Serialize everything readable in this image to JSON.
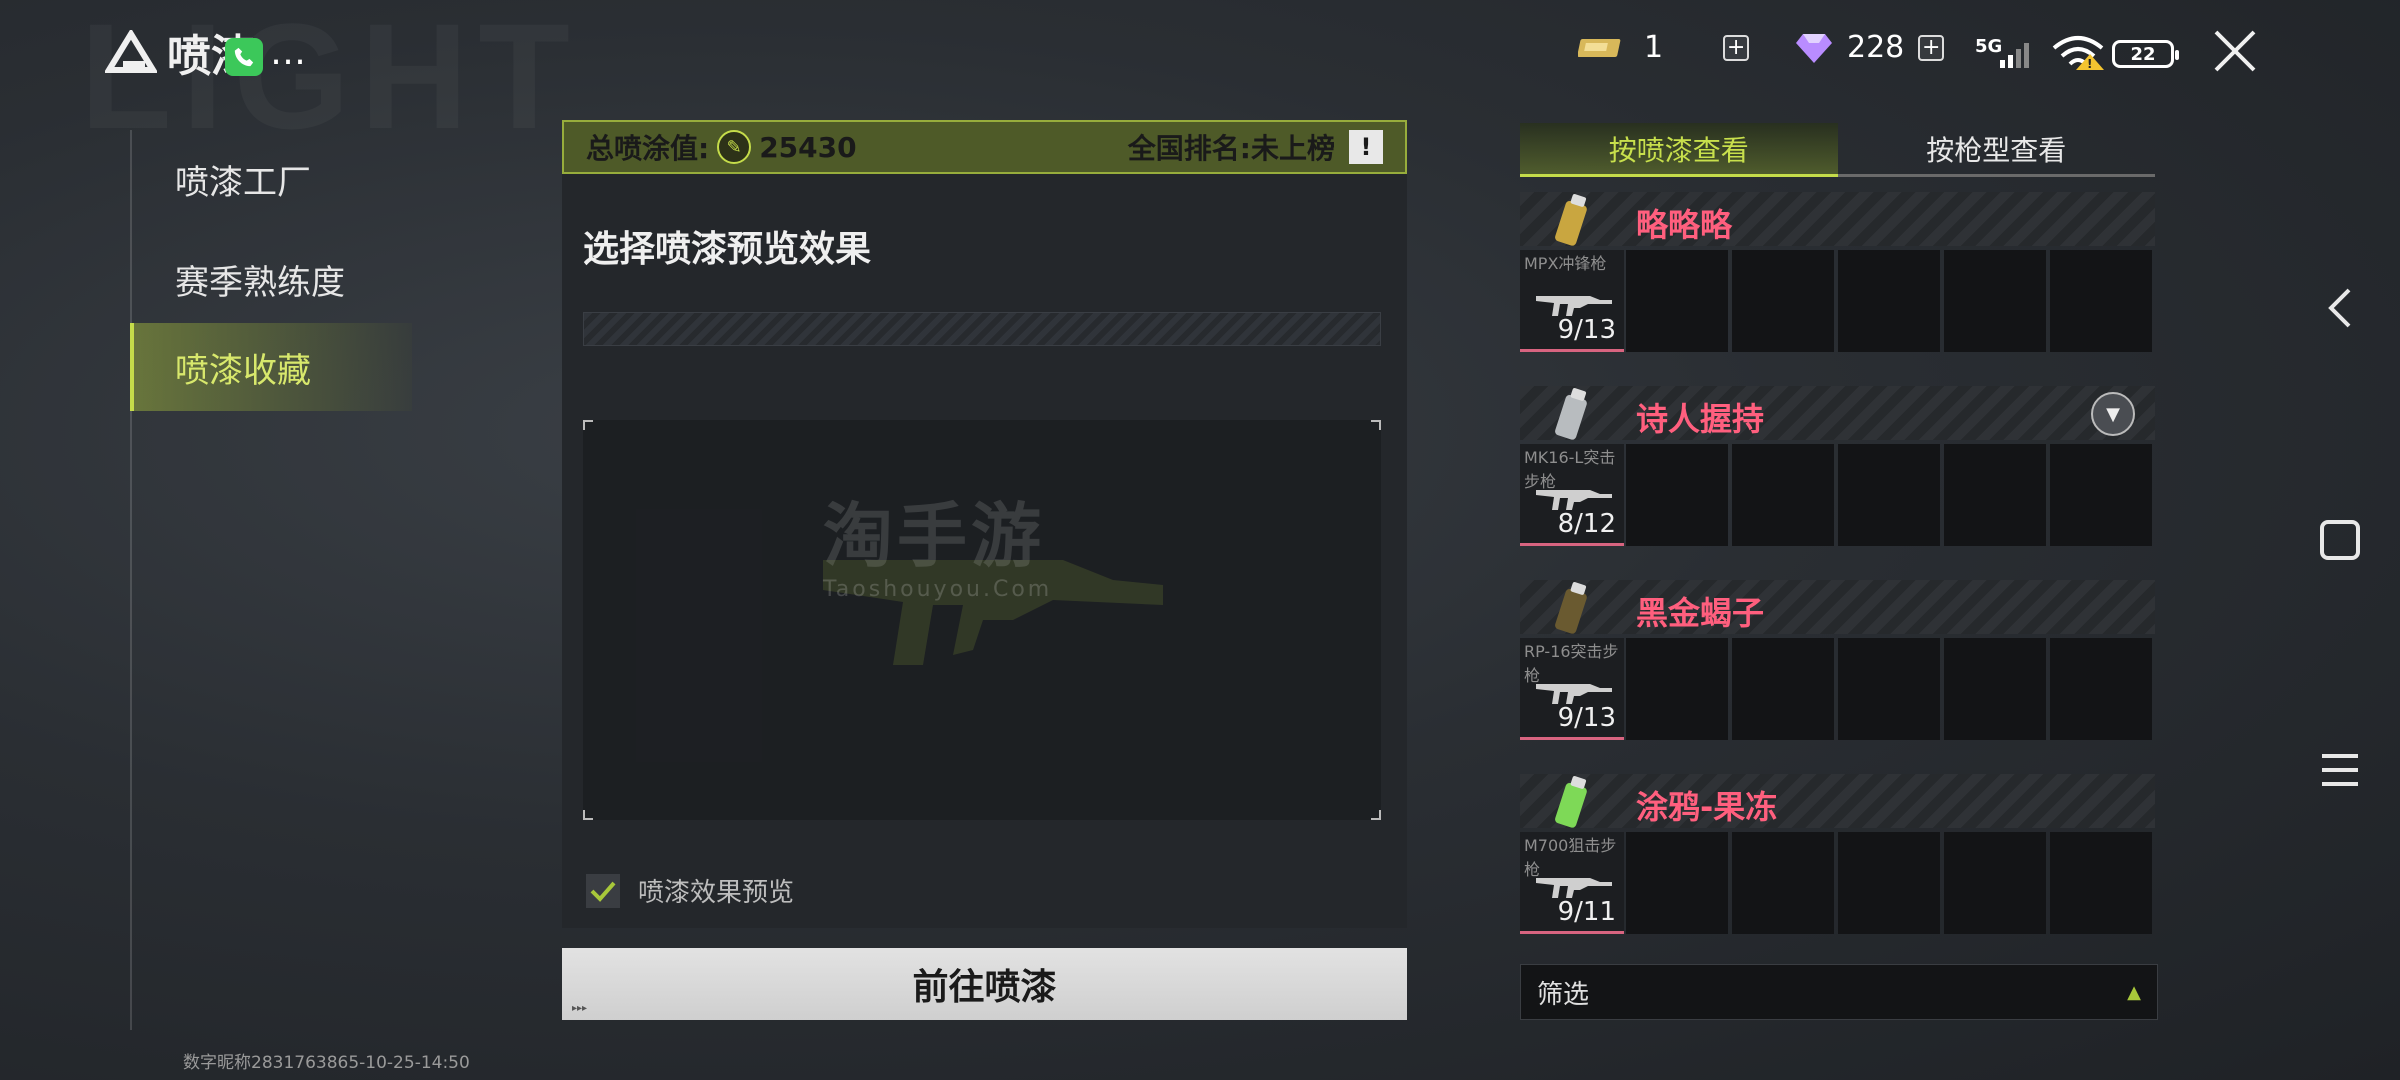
{
  "header": {
    "title": "喷漆",
    "title_suffix": "…",
    "currency_gold": "1",
    "currency_diamond": "228",
    "status_network": "5G",
    "status_battery": "22"
  },
  "left_nav": {
    "items": [
      {
        "label": "喷漆工厂"
      },
      {
        "label": "赛季熟练度"
      },
      {
        "label": "喷漆收藏"
      }
    ],
    "active_index": 2,
    "footer": "数字昵称2831763865-10-25-14:50"
  },
  "center": {
    "score_label": "总喷涂值:",
    "score_value": "25430",
    "rank_label": "全国排名:未上榜",
    "warn_glyph": "!",
    "preview_title": "选择喷漆预览效果",
    "checkbox_label": "喷漆效果预览",
    "checkbox_checked": true,
    "watermark_cn": "淘手游",
    "watermark_en": "Taoshouyou.Com",
    "go_button": "前往喷漆"
  },
  "right": {
    "tabs": [
      {
        "label": "按喷漆查看",
        "active": true
      },
      {
        "label": "按枪型查看",
        "active": false
      }
    ],
    "groups": [
      {
        "name": "略略略",
        "gun": "MPX冲锋枪",
        "count": "9/13",
        "spray_color": "#c9a640"
      },
      {
        "name": "诗人握持",
        "gun": "MK16-L突击步枪",
        "count": "8/12",
        "spray_color": "#b8bcbf",
        "expanded": true
      },
      {
        "name": "黑金蝎子",
        "gun": "RP-16突击步枪",
        "count": "9/13",
        "spray_color": "#6a5a30"
      },
      {
        "name": "涂鸦-果冻",
        "gun": "M700狙击步枪",
        "count": "9/11",
        "spray_color": "#7ed957"
      }
    ],
    "filter_label": "筛选"
  },
  "colors": {
    "accent": "#c5dc4a",
    "name_pink": "#ff5f7e",
    "score_bar": "#4e5a28"
  }
}
